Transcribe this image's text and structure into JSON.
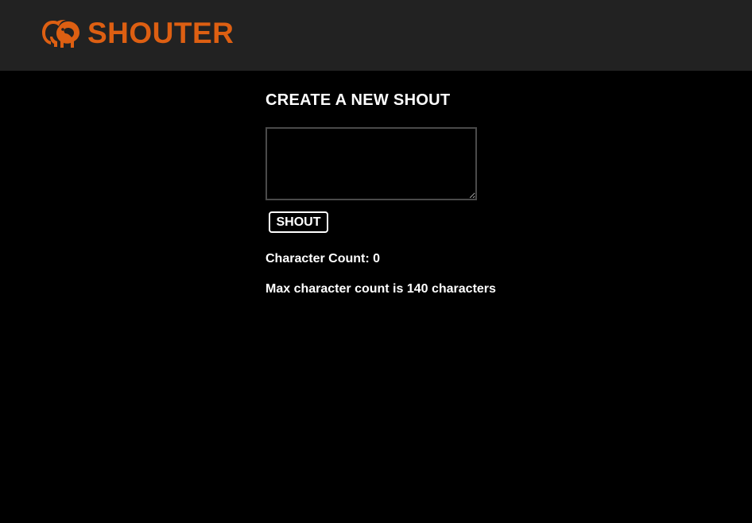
{
  "header": {
    "brand_name": "SHOUTER",
    "logo_icon": "elephant-icon",
    "brand_color": "#DD5F12",
    "background_color": "#222222"
  },
  "main": {
    "title": "CREATE A NEW SHOUT",
    "textarea": {
      "value": "",
      "placeholder": ""
    },
    "shout_button_label": "SHOUT",
    "character_count_label": "Character Count:",
    "character_count_value": "0",
    "max_notice": "Max character count is 140 characters"
  },
  "colors": {
    "page_background": "#000000",
    "text": "#FFFFFF",
    "textarea_border": "#4A4A4A"
  }
}
